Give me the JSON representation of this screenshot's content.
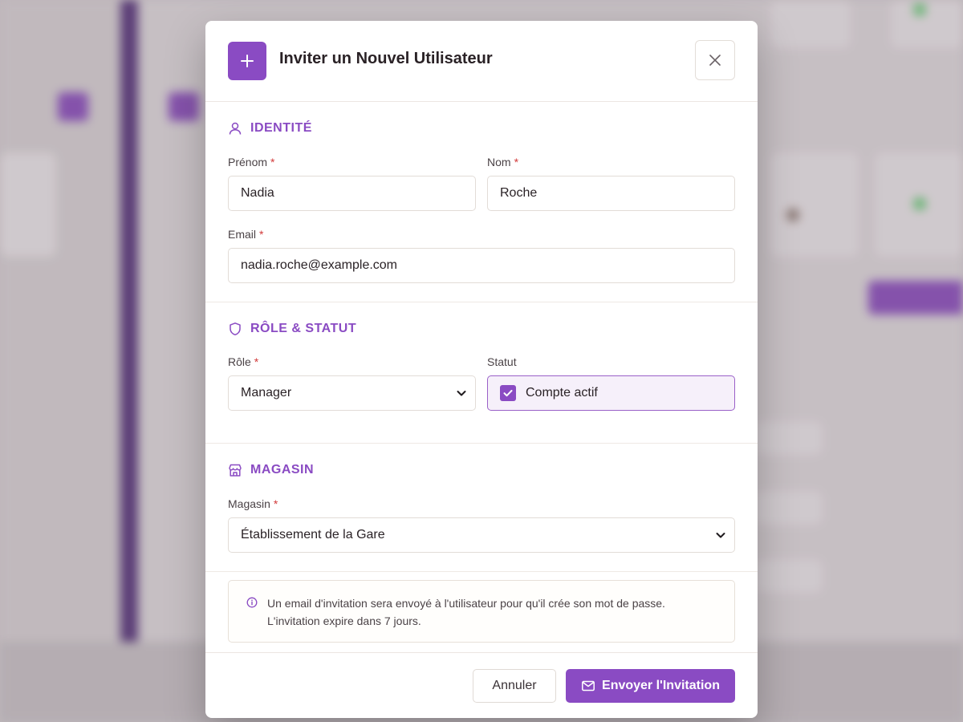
{
  "modal": {
    "title": "Inviter un Nouvel Utilisateur",
    "accent_color": "#8a4bc3"
  },
  "identite": {
    "heading": "IDENTITÉ",
    "prenom_label": "Prénom",
    "prenom_value": "Nadia",
    "nom_label": "Nom",
    "nom_value": "Roche",
    "email_label": "Email",
    "email_value": "nadia.roche@example.com",
    "required_mark": "*"
  },
  "role_statut": {
    "heading": "RÔLE & STATUT",
    "role_label": "Rôle",
    "role_value": "Manager",
    "statut_label": "Statut",
    "checkbox_label": "Compte actif",
    "checkbox_checked": true
  },
  "magasin": {
    "heading": "MAGASIN",
    "label": "Magasin",
    "value": "Établissement de la Gare"
  },
  "info": {
    "line1": "Un email d'invitation sera envoyé à l'utilisateur pour qu'il crée son mot de passe.",
    "line2": "L'invitation expire dans 7 jours."
  },
  "footer": {
    "cancel_label": "Annuler",
    "send_label": "Envoyer l'Invitation"
  }
}
